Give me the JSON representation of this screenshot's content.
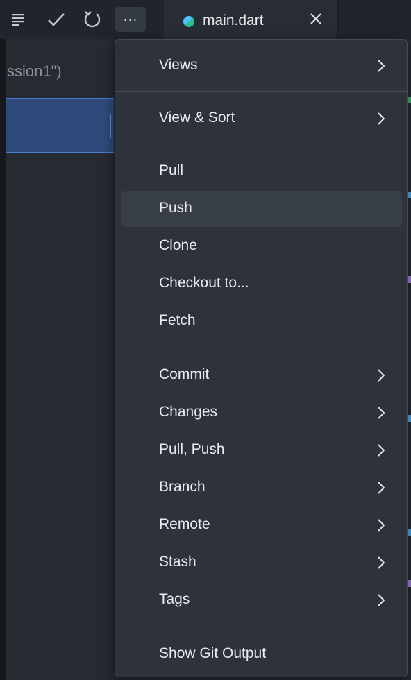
{
  "toolbar": {
    "icons": [
      "list-icon",
      "check-icon",
      "refresh-icon",
      "more-icon"
    ],
    "more_label": "···"
  },
  "tab": {
    "label": "main.dart",
    "close_label": "✕"
  },
  "editor": {
    "code_fragment": "ssion1\")"
  },
  "menu": {
    "groups": [
      {
        "items": [
          {
            "label": "Views",
            "submenu": true
          }
        ]
      },
      {
        "items": [
          {
            "label": "View & Sort",
            "submenu": true
          }
        ]
      },
      {
        "items": [
          {
            "label": "Pull",
            "submenu": false
          },
          {
            "label": "Push",
            "submenu": false,
            "hovered": true
          },
          {
            "label": "Clone",
            "submenu": false
          },
          {
            "label": "Checkout to...",
            "submenu": false
          },
          {
            "label": "Fetch",
            "submenu": false
          }
        ]
      },
      {
        "items": [
          {
            "label": "Commit",
            "submenu": true
          },
          {
            "label": "Changes",
            "submenu": true
          },
          {
            "label": "Pull, Push",
            "submenu": true
          },
          {
            "label": "Branch",
            "submenu": true
          },
          {
            "label": "Remote",
            "submenu": true
          },
          {
            "label": "Stash",
            "submenu": true
          },
          {
            "label": "Tags",
            "submenu": true
          }
        ]
      },
      {
        "items": [
          {
            "label": "Show Git Output",
            "submenu": false
          }
        ]
      }
    ]
  },
  "colors": {
    "menu_bg": "#2d323b",
    "hover_bg": "#383e48",
    "selection": "#2e4a7a",
    "accent_border": "#4c7ad8"
  }
}
